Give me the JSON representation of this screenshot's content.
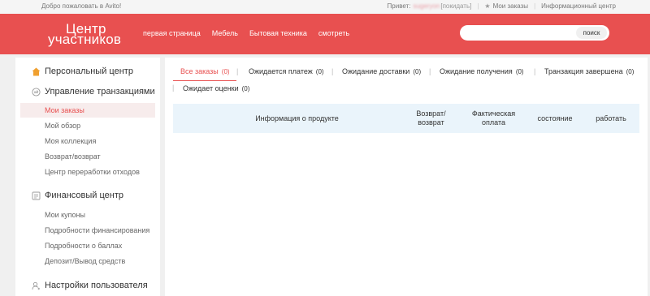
{
  "topbar": {
    "welcome": "Добро пожаловать в Avito!",
    "greeting": "Привет:",
    "username": "sugeryon",
    "logout": "[покидать]",
    "my_orders": "Мои заказы",
    "info_center": "Информационный центр"
  },
  "header": {
    "logo_line1": "Центр",
    "logo_line2": "участников",
    "nav": [
      "первая страница",
      "Мебель",
      "Бытовая техника",
      "смотреть"
    ],
    "search_placeholder": "",
    "search_button": "поиск"
  },
  "sidebar": {
    "personal_center": "Персональный центр",
    "transactions": {
      "title": "Управление транзакциями",
      "items": [
        "Мои заказы",
        "Мой обзор",
        "Моя коллекция",
        "Возврат/возврат",
        "Центр переработки отходов"
      ]
    },
    "finance": {
      "title": "Финансовый центр",
      "items": [
        "Мои купоны",
        "Подробности финансирования",
        "Подробности о баллах",
        "Депозит/Вывод средств"
      ]
    },
    "user_settings": "Настройки пользователя"
  },
  "tabs": [
    {
      "label": "Все заказы",
      "count": "(0)"
    },
    {
      "label": "Ожидается платеж",
      "count": "(0)"
    },
    {
      "label": "Ожидание доставки",
      "count": "(0)"
    },
    {
      "label": "Ожидание получения",
      "count": "(0)"
    },
    {
      "label": "Транзакция завершена",
      "count": "(0)"
    },
    {
      "label": "Ожидает оценки",
      "count": "(0)"
    }
  ],
  "table_headers": {
    "product": "Информация о продукте",
    "return_l1": "Возврат/",
    "return_l2": "возврат",
    "paid_l1": "Фактическая",
    "paid_l2": "оплата",
    "status": "состояние",
    "action": "работать"
  },
  "colors": {
    "brand": "#e85050",
    "table_header_bg": "#eaf4fb"
  }
}
